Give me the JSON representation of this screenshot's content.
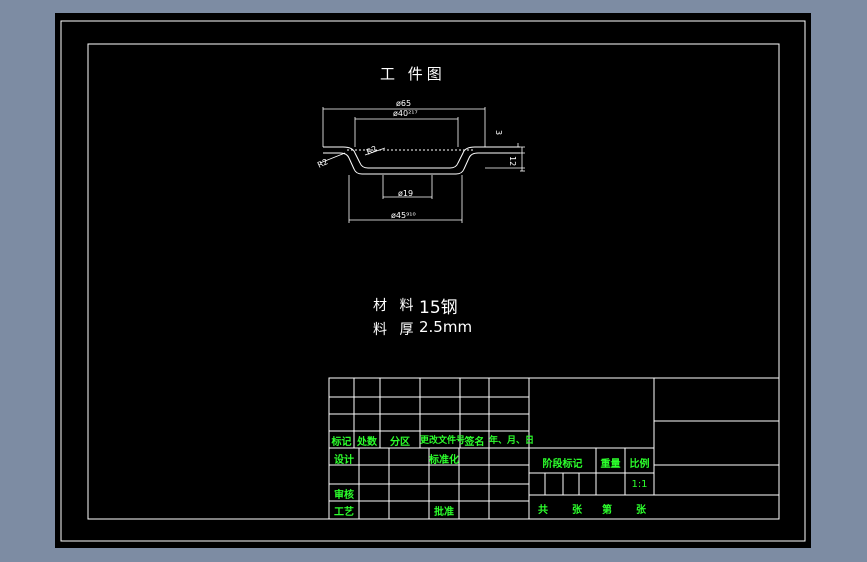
{
  "drawing": {
    "part_title": "工 件图",
    "dimensions": {
      "d65": "ø65",
      "d40": "ø40²¹⁷",
      "d19": "ø19",
      "d45": "ø45⁹¹⁰",
      "r2_left": "R2",
      "r2_inner": "R2",
      "h3": "3",
      "h12": "12"
    },
    "material_label": "材 料",
    "material_value": "15钢",
    "thickness_label": "料 厚",
    "thickness_value": "2.5mm"
  },
  "title_block": {
    "header_mark": "标记",
    "header_count": "处数",
    "header_zone": "分区",
    "header_doc": "更改文件号",
    "header_sign": "签名",
    "header_date": "年、月、日",
    "design": "设计",
    "standardize": "标准化",
    "review": "审核",
    "process": "工艺",
    "approve": "批准",
    "stage_mark": "阶段标记",
    "weight": "重量",
    "scale_label": "比例",
    "scale_value": "1:1",
    "total": "共",
    "sheets1": "张",
    "page": "第",
    "sheets2": "张"
  },
  "colors": {
    "background": "#7d8ca3",
    "sheet": "#000000",
    "lines": "#ffffff",
    "block_text": "#2cff2c"
  }
}
